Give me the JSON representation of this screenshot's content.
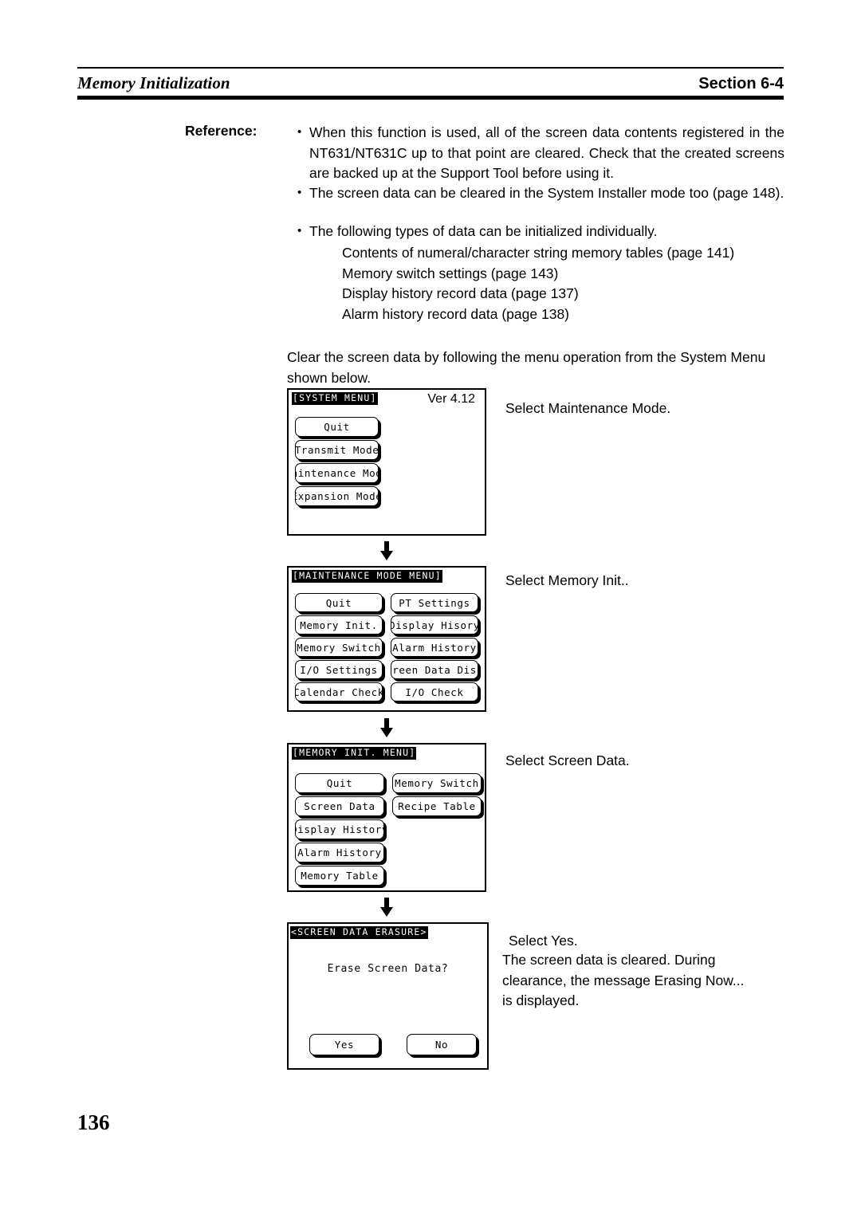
{
  "header": {
    "left_title": "Memory Initialization",
    "right_title": "Section 6-4"
  },
  "reference": {
    "label": "Reference:",
    "bullets": [
      "When this function is used, all of the screen data contents registered in the NT631/NT631C up to that point are cleared. Check that the created screens are backed up at the Support Tool before using it.",
      "The screen data can be cleared in the System Installer mode too (page 148).",
      "The following types of data can be initialized individually."
    ],
    "sub_items": [
      "Contents of numeral/character string memory tables (page 141)",
      "Memory switch settings (page 143)",
      "Display history record data (page 137)",
      "Alarm history record data (page 138)"
    ]
  },
  "intro_paragraph": "Clear the screen data by following the menu operation from the System Menu shown below.",
  "flow": {
    "screen1": {
      "title": "[SYSTEM MENU]",
      "version": "Ver 4.12",
      "buttons": [
        "Quit",
        "Transmit Mode",
        "Maintenance Mode",
        "Expansion Mode"
      ],
      "annotation": "Select Maintenance Mode."
    },
    "screen2": {
      "title": "[MAINTENANCE MODE MENU]",
      "left_buttons": [
        "Quit",
        "Memory Init.",
        "Memory Switch",
        "I/O Settings",
        "Calendar Check"
      ],
      "right_buttons": [
        "PT Settings",
        "Display Hisory",
        "Alarm History",
        "Screen Data Disp.",
        "I/O Check"
      ],
      "annotation": "Select Memory Init.."
    },
    "screen3": {
      "title": "[MEMORY INIT. MENU]",
      "left_buttons": [
        "Quit",
        "Screen Data",
        "Display History",
        "Alarm History",
        "Memory Table"
      ],
      "right_buttons": [
        "Memory Switch",
        "Recipe Table"
      ],
      "annotation": "Select Screen Data."
    },
    "screen4": {
      "title": "<SCREEN DATA ERASURE>",
      "message": "Erase Screen Data?",
      "buttons": [
        "Yes",
        "No"
      ],
      "annotation_line1": "Select Yes.",
      "annotation_line2": "The screen data is cleared. During\nclearance, the message Erasing Now...\nis displayed."
    },
    "arrow_icon": "down-arrow-icon"
  },
  "page_number": "136"
}
